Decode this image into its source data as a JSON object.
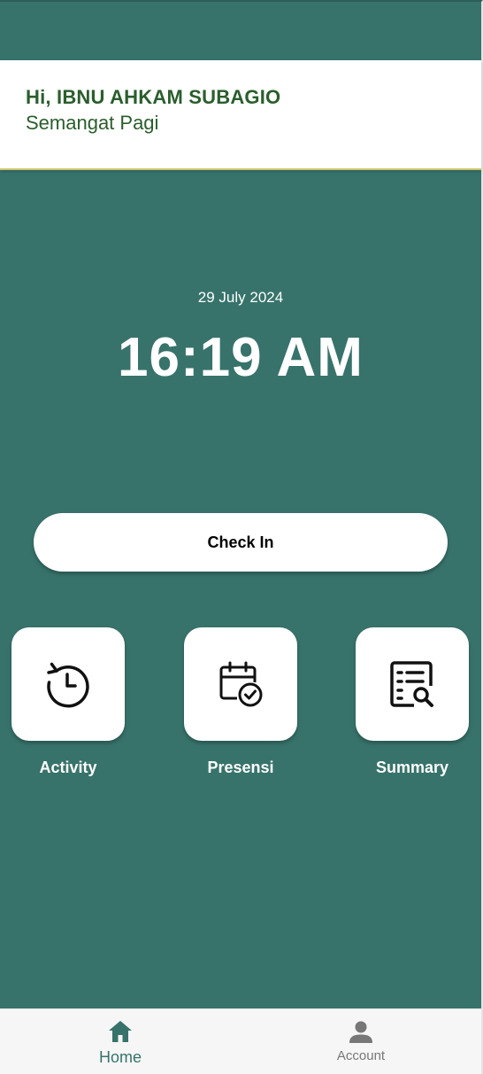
{
  "header": {
    "greeting": "Hi, IBNU AHKAM SUBAGIO",
    "subgreeting": "Semangat Pagi"
  },
  "clock": {
    "date": "29 July 2024",
    "time": "16:19 AM"
  },
  "actions": {
    "check_in_label": "Check In"
  },
  "menu": [
    {
      "label": "Activity",
      "icon": "history-clock-icon"
    },
    {
      "label": "Presensi",
      "icon": "calendar-check-icon"
    },
    {
      "label": "Summary",
      "icon": "document-search-icon"
    }
  ],
  "bottom_nav": [
    {
      "label": "Home",
      "icon": "home-icon",
      "active": true
    },
    {
      "label": "Account",
      "icon": "person-icon",
      "active": false
    }
  ],
  "colors": {
    "primary": "#37736b",
    "header_text": "#2a5e2c",
    "surface": "#ffffff",
    "nav_background": "#f6f6f6"
  }
}
